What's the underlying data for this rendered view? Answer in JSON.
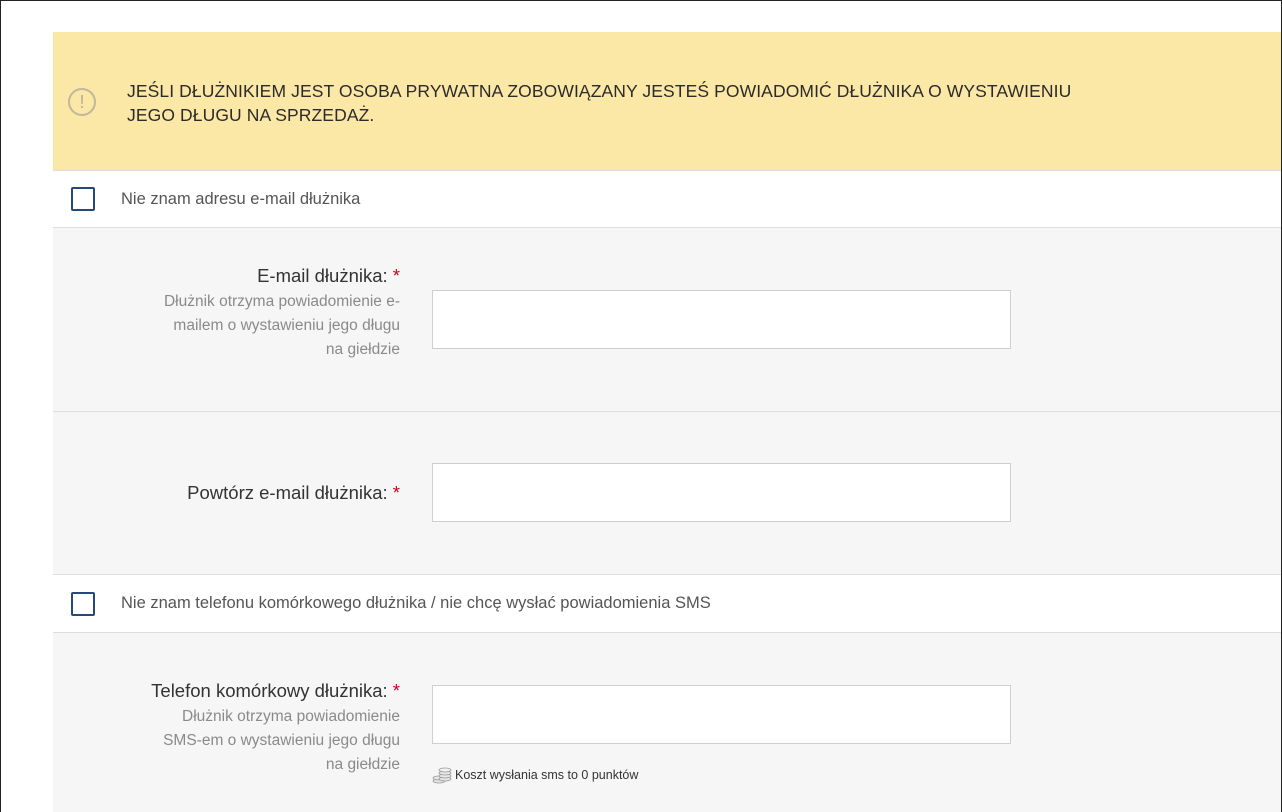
{
  "alert": {
    "icon": "exclamation-circle-icon",
    "text_line1": "JEŚLI DŁUŻNIKIEM JEST OSOBA PRYWATNA ZOBOWIĄZANY JESTEŚ POWIADOMIĆ DŁUŻNIKA O WYSTAWIENIU",
    "text_line2": "JEGO DŁUGU NA SPRZEDAŻ."
  },
  "no_email_checkbox": {
    "label": "Nie znam adresu e-mail dłużnika",
    "checked": false
  },
  "email_field": {
    "label": "E-mail dłużnika:",
    "required_mark": "*",
    "help_lines": [
      "Dłużnik otrzyma powiadomienie e-",
      "mailem o wystawieniu jego długu",
      "na giełdzie"
    ],
    "value": ""
  },
  "repeat_email_field": {
    "label": "Powtórz e-mail dłużnika:",
    "required_mark": "*",
    "value": ""
  },
  "no_phone_checkbox": {
    "label": "Nie znam telefonu komórkowego dłużnika / nie chcę wysłać powiadomienia SMS",
    "checked": false
  },
  "phone_field": {
    "label": "Telefon komórkowy dłużnika:",
    "required_mark": "*",
    "help_lines": [
      "Dłużnik otrzyma powiadomienie",
      "SMS-em o wystawieniu jego długu",
      "na giełdzie"
    ],
    "value": "",
    "cost_icon": "coins-icon",
    "cost_text": "Koszt wysłania sms to 0 punktów"
  },
  "colors": {
    "alert_bg": "#fbe7a6",
    "checkbox_border": "#244a7a",
    "required": "#d0021b",
    "field_bg": "#f6f6f6"
  }
}
